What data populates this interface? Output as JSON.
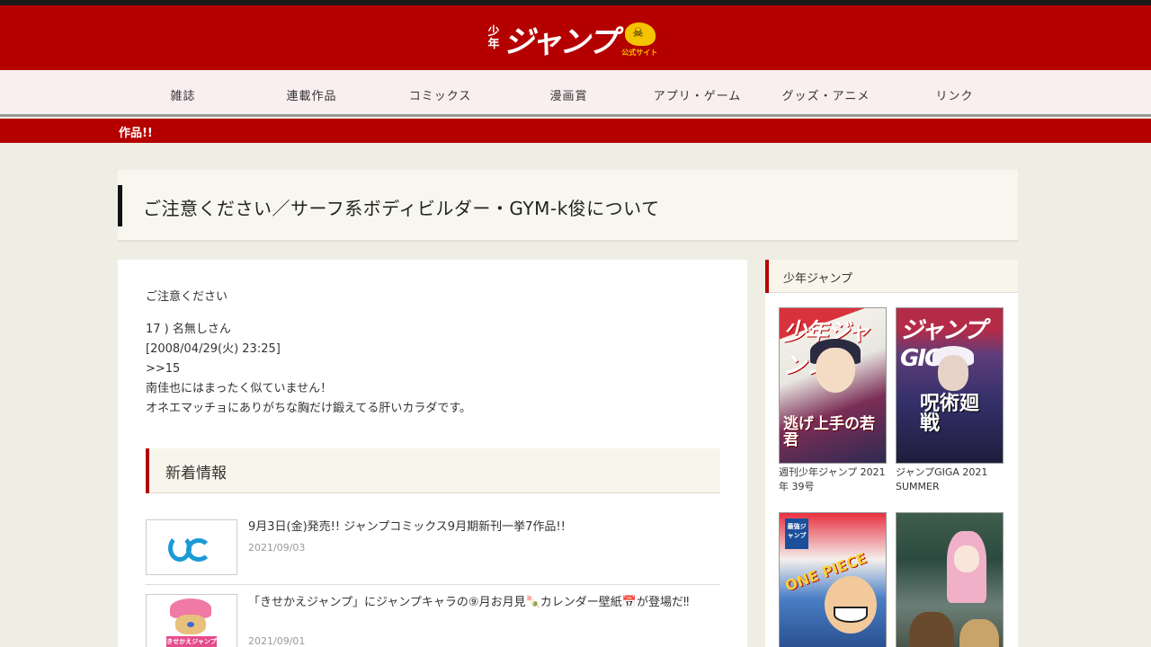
{
  "header": {
    "logo_small": "少年",
    "logo_main": "ジャンプ",
    "logo_sub": "公式サイト"
  },
  "nav": [
    "雑誌",
    "連載作品",
    "コミックス",
    "漫画賞",
    "アプリ・ゲーム",
    "グッズ・アニメ",
    "リンク"
  ],
  "ticker": "作品!!",
  "article": {
    "title": "ご注意ください／サーフ系ボディビルダー・GYM-k俊について",
    "lines": [
      "ご注意ください",
      "17 ) 名無しさん",
      "[2008/04/29(火) 23:25]",
      ">>15",
      "南佳也にはまったく似ていません！",
      "オネエマッチョにありがちな胸だけ鍛えてる肝いカラダです。"
    ]
  },
  "news": {
    "heading": "新着情報",
    "items": [
      {
        "title": "9月3日(金)発売!! ジャンプコミックス9月期新刊一挙7作品!!",
        "date": "2021/09/03"
      },
      {
        "title": "「きせかえジャンプ」にジャンプキャラの⑨月お月見🍡カレンダー壁紙📅が登場だ‼",
        "date": "2021/09/01"
      }
    ],
    "thumb2_label": "きせかえジャンプ"
  },
  "sidebar": {
    "heading": "少年ジャンプ",
    "covers": [
      {
        "caption": "週刊少年ジャンプ 2021年 39号",
        "mast": "少年ジャンプ",
        "art_text": "逃げ上手の若君"
      },
      {
        "caption": "ジャンプGIGA 2021 SUMMER",
        "mast": "ジャンプ GIGA",
        "art_text": "呪術廻戦"
      },
      {
        "caption": "",
        "mast": "最強ジャンプ",
        "art_text": "ONE PIECE"
      },
      {
        "caption": "",
        "mast": "",
        "art_text": ""
      }
    ]
  },
  "colors": {
    "brand_red": "#b50000",
    "nav_bg": "#faeff0",
    "page_bg": "#efeee4"
  }
}
